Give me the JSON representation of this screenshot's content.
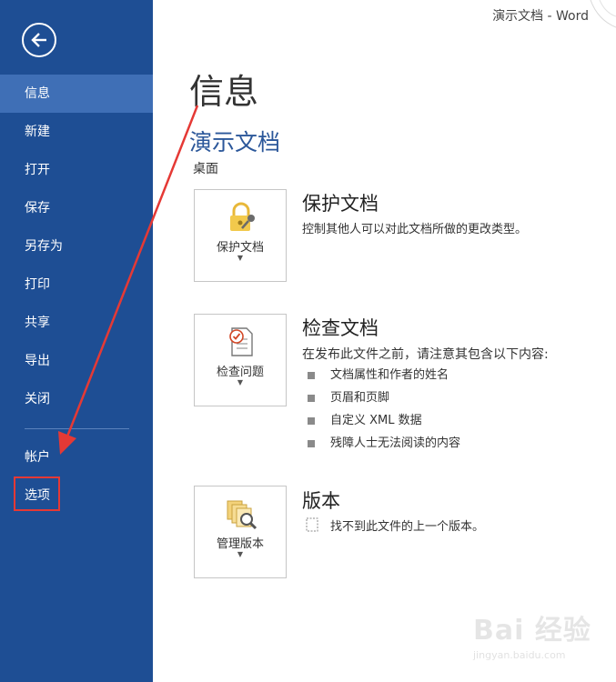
{
  "window": {
    "title": "演示文档 - Word"
  },
  "sidebar": {
    "back_icon": "arrow-left-icon",
    "items": [
      {
        "label": "信息",
        "active": true
      },
      {
        "label": "新建"
      },
      {
        "label": "打开"
      },
      {
        "label": "保存"
      },
      {
        "label": "另存为"
      },
      {
        "label": "打印"
      },
      {
        "label": "共享"
      },
      {
        "label": "导出"
      },
      {
        "label": "关闭"
      }
    ],
    "bottom_items": [
      {
        "label": "帐户"
      },
      {
        "label": "选项"
      }
    ],
    "bg_color": "#1e4e94",
    "active_color": "#3f6fb6"
  },
  "main": {
    "title": "信息",
    "doc_name": "演示文档",
    "doc_location": "桌面",
    "sections": [
      {
        "button_label": "保护文档",
        "icon": "lock-key-icon",
        "title": "保护文档",
        "description": "控制其他人可以对此文档所做的更改类型。"
      },
      {
        "button_label": "检查问题",
        "icon": "document-check-icon",
        "title": "检查文档",
        "description": "在发布此文件之前，请注意其包含以下内容:",
        "bullets": [
          "文档属性和作者的姓名",
          "页眉和页脚",
          "自定义 XML 数据",
          "残障人士无法阅读的内容"
        ]
      },
      {
        "button_label": "管理版本",
        "icon": "versions-search-icon",
        "title": "版本",
        "version_note": "找不到此文件的上一个版本。"
      }
    ]
  },
  "annotation": {
    "arrow_color": "#e53935"
  },
  "watermark": {
    "text": "Bai 经验",
    "sub": "jingyan.baidu.com"
  }
}
